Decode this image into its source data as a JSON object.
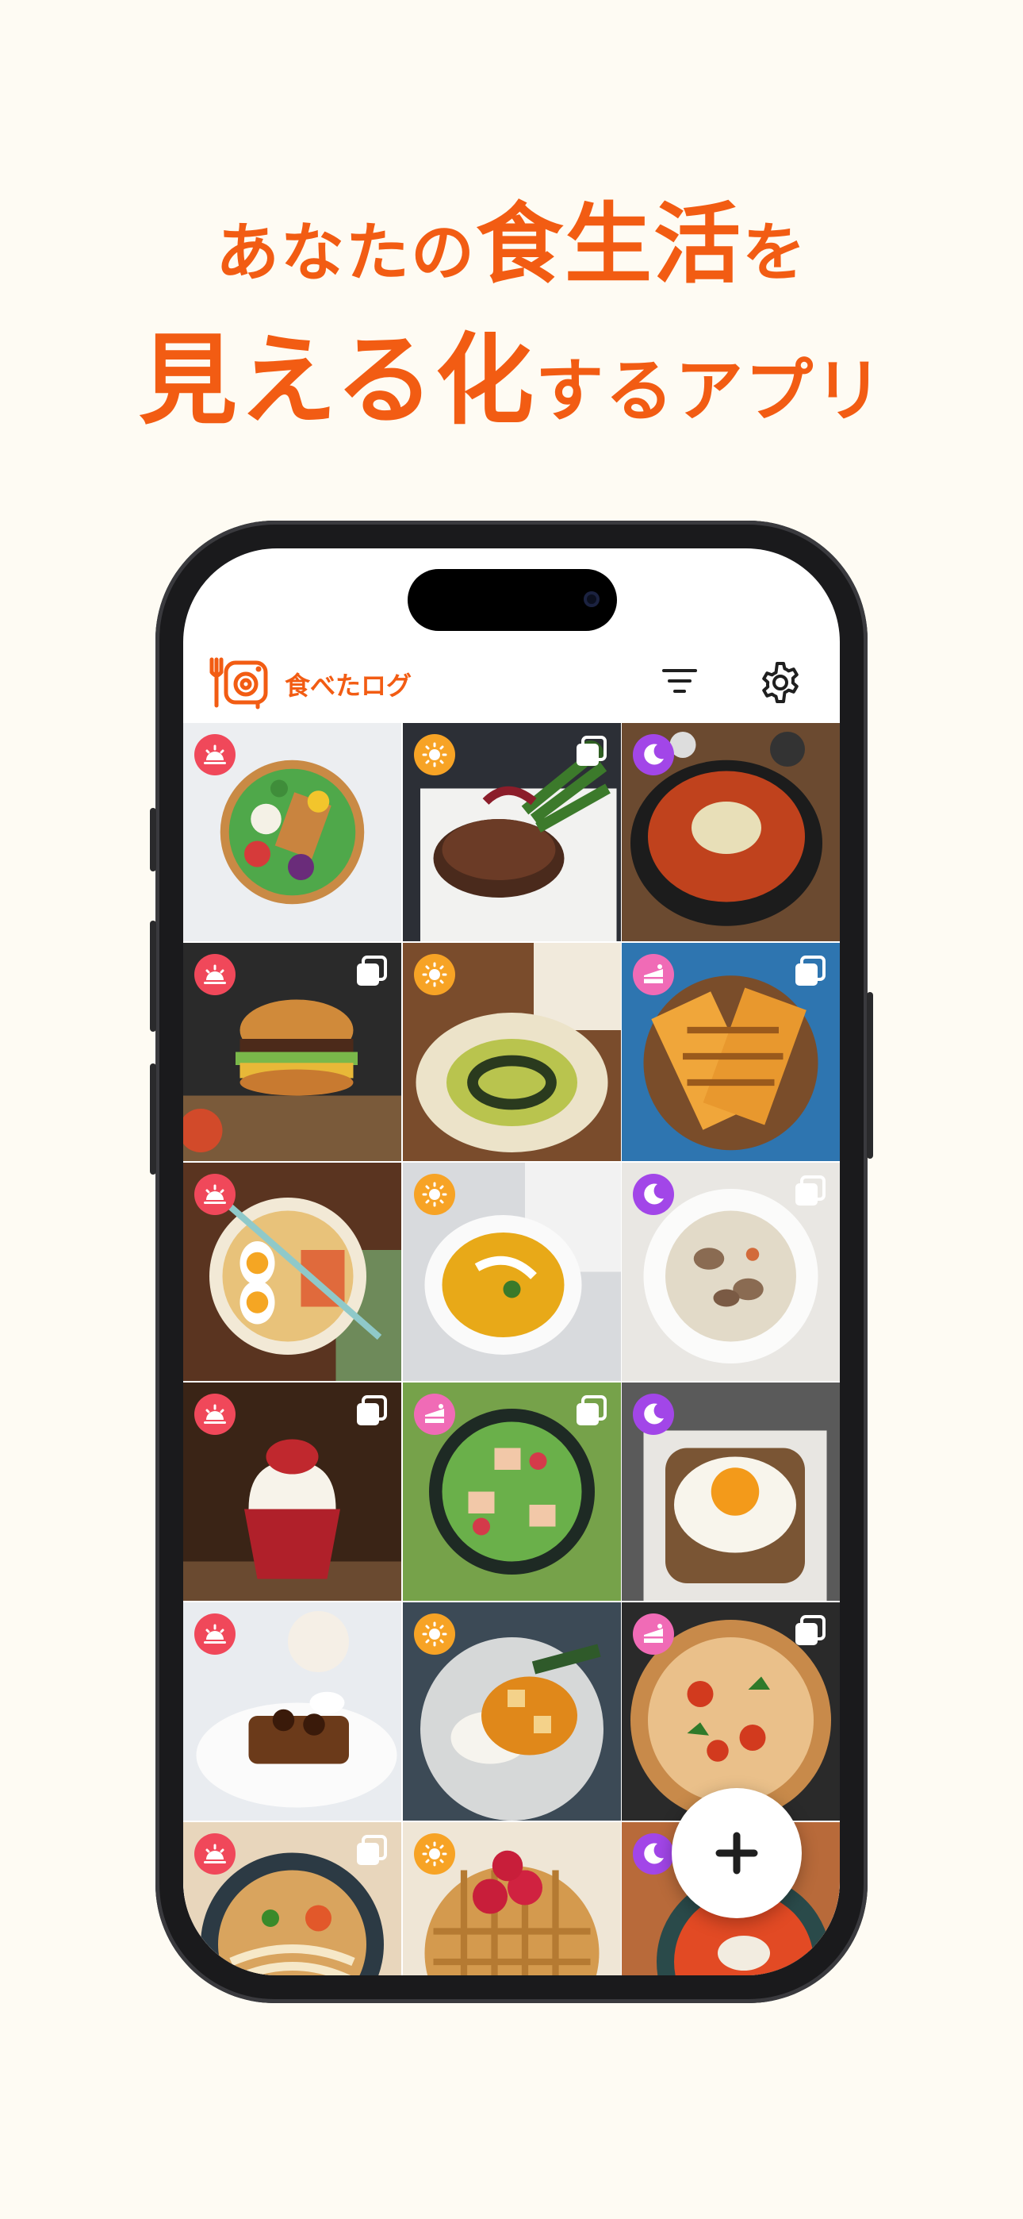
{
  "headline": {
    "line1_pre": "あなたの",
    "line1_em": "食生活",
    "line1_post": "を",
    "line2_em": "見える化",
    "line2_post": "するアプリ"
  },
  "app": {
    "title": "食べたログ"
  },
  "icons": {
    "logo": "plate-camera-logo-icon",
    "filter": "filter-icon",
    "settings": "gear-icon",
    "add": "plus-icon",
    "multi": "multiple-photos-icon",
    "meals": {
      "breakfast": "sunrise-icon",
      "lunch": "sun-icon",
      "dinner": "moon-icon",
      "snack": "cake-icon"
    }
  },
  "colors": {
    "accent": "#F25C13",
    "breakfast": "#F0485A",
    "lunch": "#F7A325",
    "dinner": "#A246E8",
    "snack": "#F06BB6"
  },
  "meals": [
    {
      "dish": "poke-bowl",
      "meal": "breakfast",
      "multi": false
    },
    {
      "dish": "steak",
      "meal": "lunch",
      "multi": true
    },
    {
      "dish": "pot-soup",
      "meal": "dinner",
      "multi": false
    },
    {
      "dish": "burger",
      "meal": "breakfast",
      "multi": true
    },
    {
      "dish": "risotto",
      "meal": "lunch",
      "multi": false
    },
    {
      "dish": "grilled-sandwich",
      "meal": "snack",
      "multi": true
    },
    {
      "dish": "ramen",
      "meal": "breakfast",
      "multi": false
    },
    {
      "dish": "pumpkin-soup",
      "meal": "lunch",
      "multi": false
    },
    {
      "dish": "clam-chowder",
      "meal": "dinner",
      "multi": true
    },
    {
      "dish": "cupcake",
      "meal": "breakfast",
      "multi": true
    },
    {
      "dish": "salad",
      "meal": "snack",
      "multi": true
    },
    {
      "dish": "egg-toast",
      "meal": "dinner",
      "multi": false
    },
    {
      "dish": "french-toast",
      "meal": "breakfast",
      "multi": false
    },
    {
      "dish": "curry",
      "meal": "lunch",
      "multi": false
    },
    {
      "dish": "pizza",
      "meal": "snack",
      "multi": true
    },
    {
      "dish": "noodle-soup",
      "meal": "breakfast",
      "multi": true
    },
    {
      "dish": "waffle",
      "meal": "lunch",
      "multi": false
    },
    {
      "dish": "tomato-soup",
      "meal": "dinner",
      "multi": false
    }
  ]
}
